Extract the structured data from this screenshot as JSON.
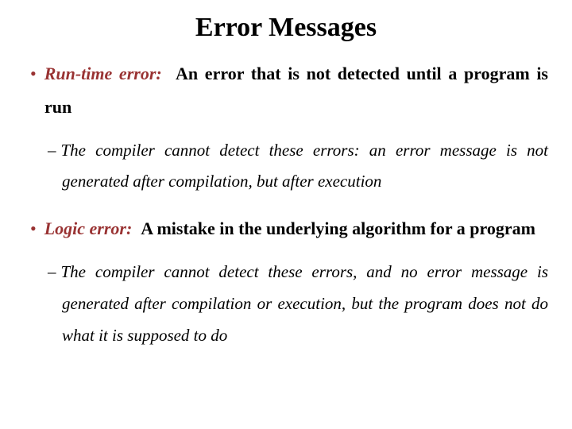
{
  "title": "Error Messages",
  "items": [
    {
      "term": "Run-time error:",
      "definition": "An error that is not detected until a program is run",
      "sub": "The compiler cannot detect these errors:  an error message is not generated after compilation, but after execution"
    },
    {
      "term": "Logic error:",
      "definition": "A mistake in the underlying algorithm for a program",
      "sub": "The compiler cannot detect these errors, and no error message is generated after compilation or execution, but the program does not do what it is supposed to do"
    }
  ]
}
